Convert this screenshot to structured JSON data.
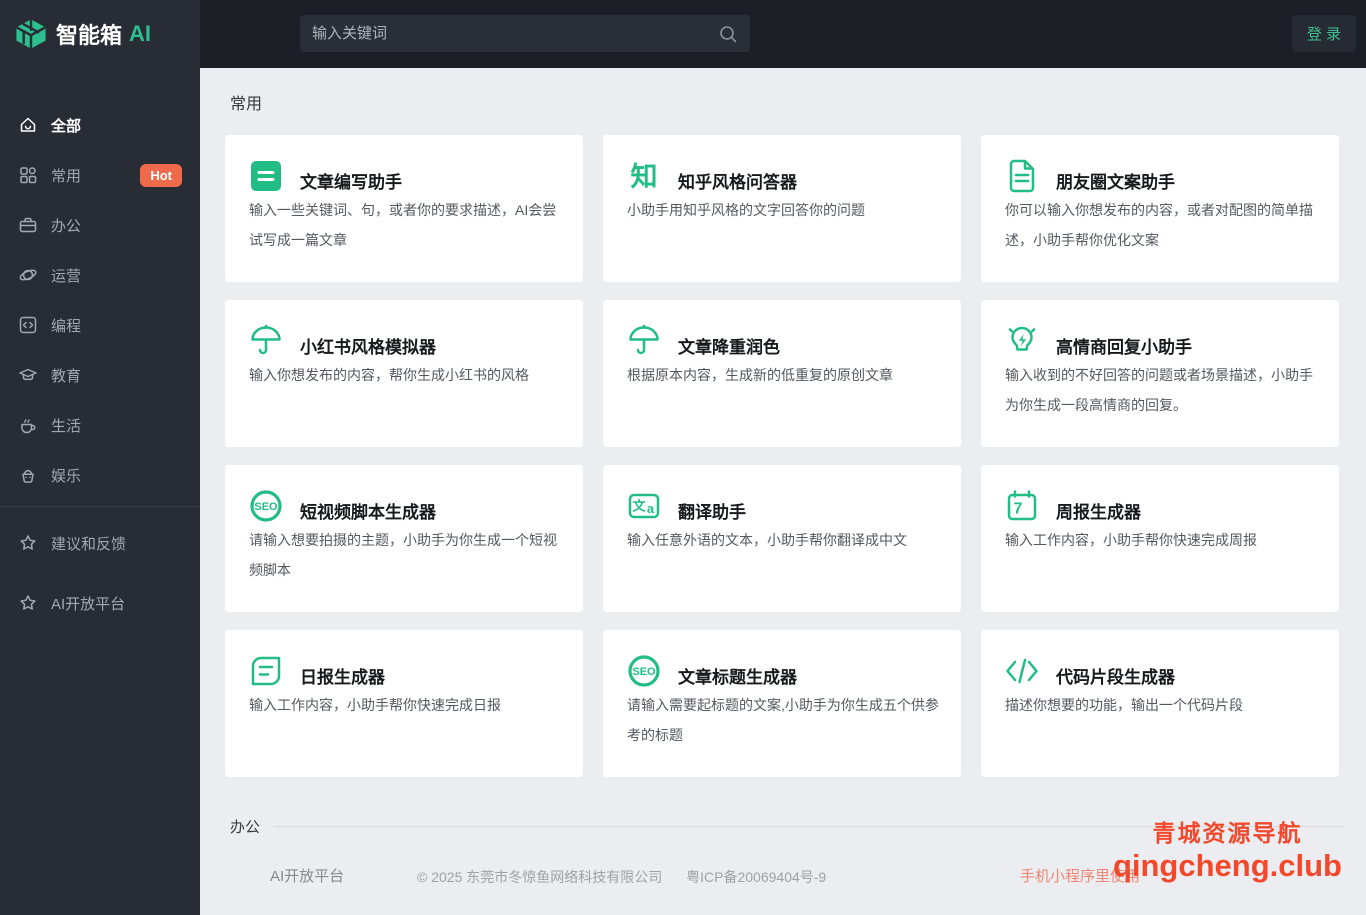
{
  "header": {
    "logo": {
      "brand": "智能箱",
      "suffix": "AI"
    },
    "search": {
      "placeholder": "输入关键词"
    },
    "login_label": "登 录"
  },
  "sidebar": {
    "items": [
      {
        "label": "全部",
        "icon": "home-icon",
        "active": true
      },
      {
        "label": "常用",
        "icon": "grid-icon",
        "badge": "Hot"
      },
      {
        "label": "办公",
        "icon": "briefcase-icon"
      },
      {
        "label": "运营",
        "icon": "operation-icon"
      },
      {
        "label": "编程",
        "icon": "code-square-icon"
      },
      {
        "label": "教育",
        "icon": "graduation-cap-icon"
      },
      {
        "label": "生活",
        "icon": "coffee-icon"
      },
      {
        "label": "娱乐",
        "icon": "entertainment-icon"
      }
    ],
    "footer_items": [
      {
        "label": "建议和反馈",
        "icon": "star-icon"
      },
      {
        "label": "AI开放平台",
        "icon": "star-icon"
      }
    ]
  },
  "main": {
    "section_title": "常用",
    "cards": [
      {
        "icon": "doc-lines-icon",
        "title": "文章编写助手",
        "desc": "输入一些关键词、句，或者你的要求描述，AI会尝试写成一篇文章"
      },
      {
        "icon": "zhihu-icon",
        "title": "知乎风格问答器",
        "desc": "小助手用知乎风格的文字回答你的问题"
      },
      {
        "icon": "document-icon",
        "title": "朋友圈文案助手",
        "desc": "你可以输入你想发布的内容，或者对配图的简单描述，小助手帮你优化文案"
      },
      {
        "icon": "umbrella-icon",
        "title": "小红书风格模拟器",
        "desc": "输入你想发布的内容，帮你生成小红书的风格"
      },
      {
        "icon": "umbrella-icon",
        "title": "文章降重润色",
        "desc": "根据原本内容，生成新的低重复的原创文章"
      },
      {
        "icon": "bulb-flash-icon",
        "title": "高情商回复小助手",
        "desc": "输入收到的不好回答的问题或者场景描述，小助手为你生成一段高情商的回复。"
      },
      {
        "icon": "seo-circle-icon",
        "title": "短视频脚本生成器",
        "desc": "请输入想要拍摄的主题，小助手为你生成一个短视频脚本"
      },
      {
        "icon": "translate-icon",
        "title": "翻译助手",
        "desc": "输入任意外语的文本，小助手帮你翻译成中文"
      },
      {
        "icon": "calendar-7-icon",
        "title": "周报生成器",
        "desc": "输入工作内容，小助手帮你快速完成周报"
      },
      {
        "icon": "leaf-doc-icon",
        "title": "日报生成器",
        "desc": "输入工作内容，小助手帮你快速完成日报"
      },
      {
        "icon": "seo-circle-icon",
        "title": "文章标题生成器",
        "desc": "请输入需要起标题的文案,小助手为你生成五个供参考的标题"
      },
      {
        "icon": "code-icon",
        "title": "代码片段生成器",
        "desc": "描述你想要的功能，输出一个代码片段"
      }
    ],
    "next_section_title": "办公"
  },
  "footer": {
    "link": "AI开放平台",
    "copyright": "© 2025 东莞市冬惊鱼网络科技有限公司",
    "icp": "粤ICP备20069404号-9",
    "right_note": "手机小程序里使用"
  },
  "watermark": {
    "line1": "青城资源导航",
    "line2": "qingcheng.club"
  },
  "colors": {
    "accent_green": "#2ebf8e",
    "icon_green": "#21bd84",
    "hot_badge": "#ee6a4b",
    "watermark_red": "#f4482c",
    "sidebar_bg": "#272c35",
    "header_bg": "#1c1f26",
    "main_bg": "#ebedf0"
  }
}
